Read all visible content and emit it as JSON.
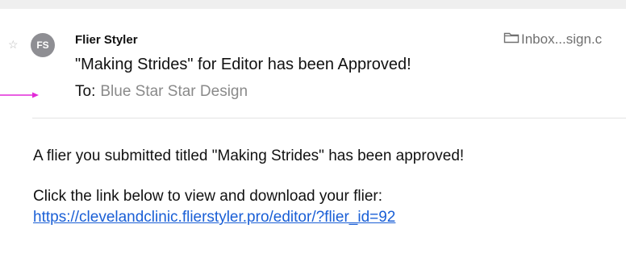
{
  "header": {
    "sender_initials": "FS",
    "sender_name": "Flier Styler",
    "mailbox": "Inbox...sign.c",
    "subject": "\"Making Strides\" for Editor has been Approved!",
    "to_label": "To:",
    "to_value": "Blue Star Star Design",
    "star_glyph": "☆"
  },
  "body": {
    "line1": "A flier you submitted titled \"Making Strides\" has been approved!",
    "line2": "Click the link below to view and download your flier:",
    "link": "https://clevelandclinic.flierstyler.pro/editor/?flier_id=92"
  },
  "colors": {
    "avatar": "#8e8e93",
    "link": "#1a5fd6",
    "annotation_arrow": "#e22ad8"
  },
  "icons": {
    "folder": "folder-icon",
    "star": "star-icon",
    "arrow": "annotation-arrow-icon"
  }
}
